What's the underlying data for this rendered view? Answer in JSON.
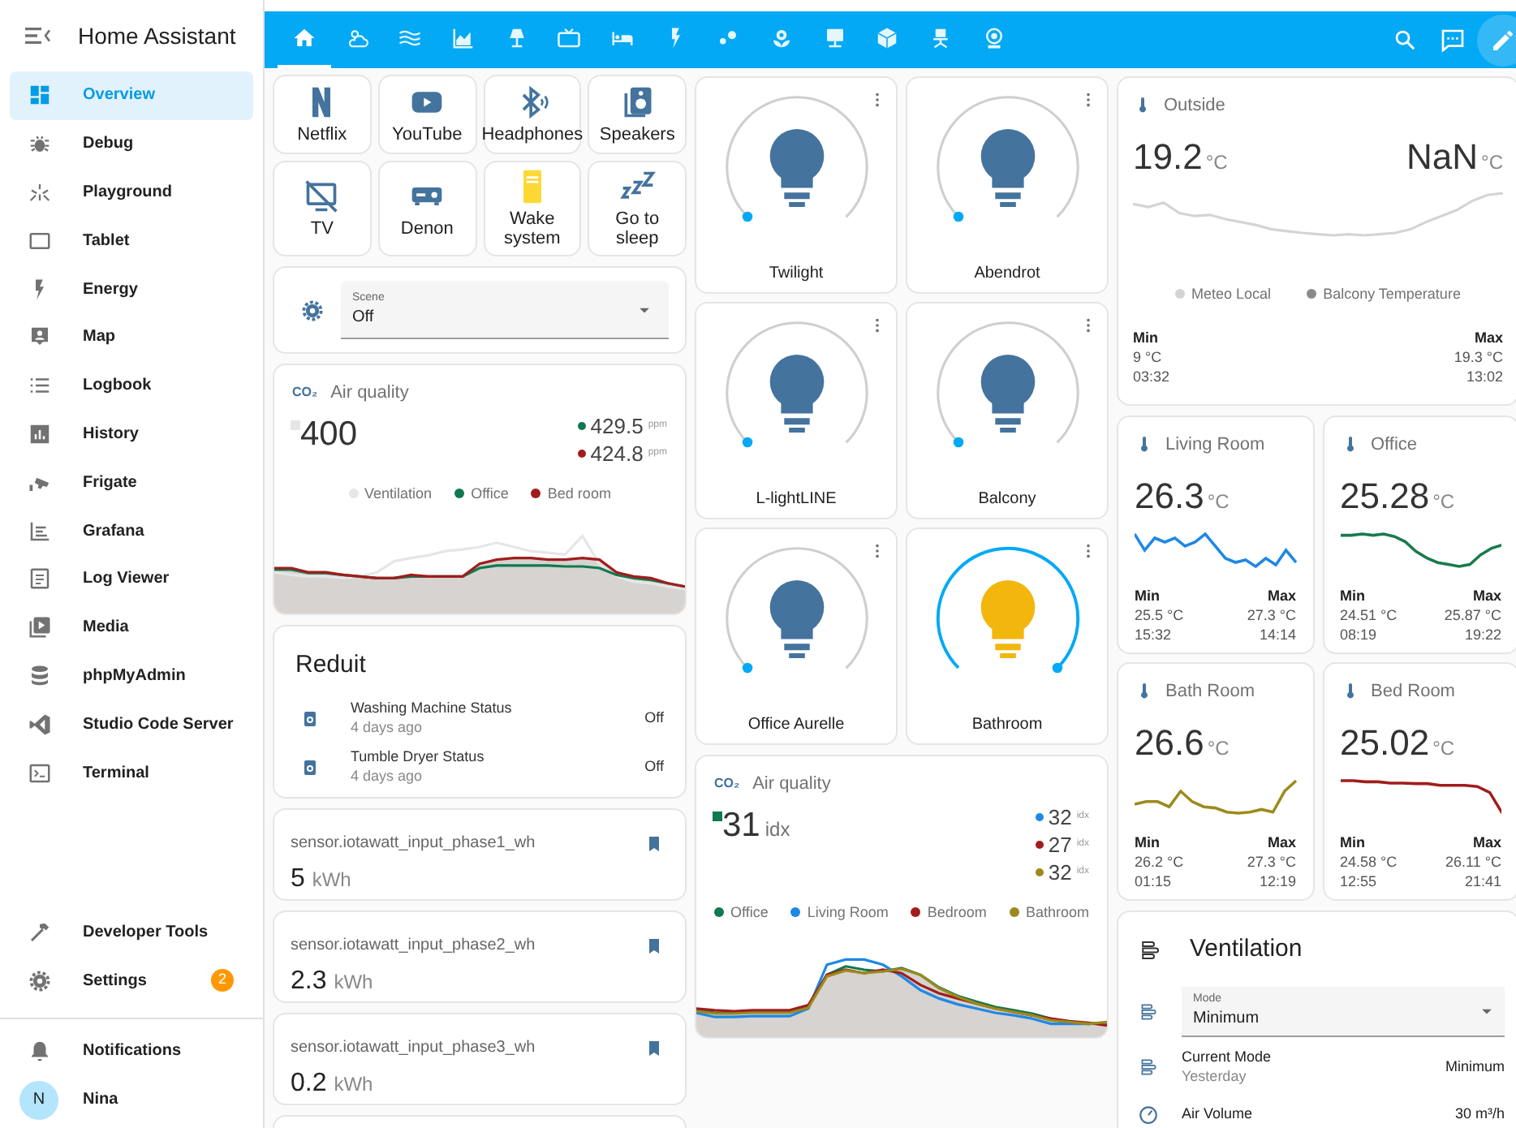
{
  "sidebar": {
    "title": "Home Assistant",
    "items": [
      {
        "label": "Overview",
        "selected": true
      },
      {
        "label": "Debug",
        "selected": false
      },
      {
        "label": "Playground",
        "selected": false
      },
      {
        "label": "Tablet",
        "selected": false
      },
      {
        "label": "Energy",
        "selected": false
      },
      {
        "label": "Map",
        "selected": false
      },
      {
        "label": "Logbook",
        "selected": false
      },
      {
        "label": "History",
        "selected": false
      },
      {
        "label": "Frigate",
        "selected": false
      },
      {
        "label": "Grafana",
        "selected": false
      },
      {
        "label": "Log Viewer",
        "selected": false
      },
      {
        "label": "Media",
        "selected": false
      },
      {
        "label": "phpMyAdmin",
        "selected": false
      },
      {
        "label": "Studio Code Server",
        "selected": false
      },
      {
        "label": "Terminal",
        "selected": false
      }
    ],
    "bottom_items": [
      {
        "label": "Developer Tools",
        "selected": false
      },
      {
        "label": "Settings",
        "selected": false,
        "badge": "2"
      }
    ],
    "notifications": {
      "label": "Notifications"
    },
    "user": {
      "initial": "N",
      "name": "Nina"
    }
  },
  "tabs": [
    {
      "selected": true
    },
    {
      "selected": false
    },
    {
      "selected": false
    },
    {
      "selected": false
    },
    {
      "selected": false
    },
    {
      "selected": false
    },
    {
      "selected": false
    },
    {
      "selected": false
    },
    {
      "selected": false
    },
    {
      "selected": false
    },
    {
      "selected": false
    },
    {
      "selected": false
    },
    {
      "selected": false
    },
    {
      "selected": false
    }
  ],
  "buttons": [
    {
      "label": "Netflix",
      "on": false
    },
    {
      "label": "YouTube",
      "on": false
    },
    {
      "label": "Headphones",
      "on": false
    },
    {
      "label": "Speakers",
      "on": false
    },
    {
      "label": "TV",
      "on": false
    },
    {
      "label": "Denon",
      "on": false
    },
    {
      "label": "Wake system",
      "on": true
    },
    {
      "label": "Go to sleep",
      "on": false
    }
  ],
  "scene": {
    "label": "Scene",
    "value": "Off"
  },
  "air_quality_1": {
    "icon_label": "CO₂",
    "title": "Air quality",
    "value": "400",
    "secondary": [
      {
        "value": "429.5",
        "unit": "ppm",
        "color": "#0f7a4f"
      },
      {
        "value": "424.8",
        "unit": "ppm",
        "color": "#a11d1d"
      }
    ],
    "legend": [
      {
        "label": "Ventilation",
        "color": "#e6e6e6"
      },
      {
        "label": "Office",
        "color": "#0f7a4f"
      },
      {
        "label": "Bed room",
        "color": "#a11d1d"
      }
    ]
  },
  "reduit": {
    "title": "Reduit",
    "rows": [
      {
        "name": "Washing Machine Status",
        "time": "4 days ago",
        "state": "Off"
      },
      {
        "name": "Tumble Dryer Status",
        "time": "4 days ago",
        "state": "Off"
      }
    ]
  },
  "sensors": [
    {
      "name": "sensor.iotawatt_input_phase1_wh",
      "value": "5",
      "unit": "kWh"
    },
    {
      "name": "sensor.iotawatt_input_phase2_wh",
      "value": "2.3",
      "unit": "kWh"
    },
    {
      "name": "sensor.iotawatt_input_phase3_wh",
      "value": "0.2",
      "unit": "kWh"
    }
  ],
  "lights": [
    {
      "name": "Twilight",
      "on": false
    },
    {
      "name": "Abendrot",
      "on": false
    },
    {
      "name": "L-lightLINE",
      "on": false
    },
    {
      "name": "Balcony",
      "on": false
    },
    {
      "name": "Office Aurelle",
      "on": false
    },
    {
      "name": "Bathroom",
      "on": true
    }
  ],
  "air_quality_2": {
    "icon_label": "CO₂",
    "title": "Air quality",
    "value": "31",
    "unit": "idx",
    "secondary": [
      {
        "value": "32",
        "unit": "idx",
        "color": "#1e88e5"
      },
      {
        "value": "27",
        "unit": "idx",
        "color": "#a11d1d"
      },
      {
        "value": "32",
        "unit": "idx",
        "color": "#9c8a1c"
      }
    ],
    "legend": [
      {
        "label": "Office",
        "color": "#0f7a4f"
      },
      {
        "label": "Living Room",
        "color": "#1e88e5"
      },
      {
        "label": "Bedroom",
        "color": "#a11d1d"
      },
      {
        "label": "Bathroom",
        "color": "#9c8a1c"
      }
    ]
  },
  "outside": {
    "title": "Outside",
    "value": "19.2",
    "unit": "°C",
    "value_2": "NaN",
    "unit_2": "°C",
    "legend": [
      {
        "label": "Meteo Local",
        "color": "#d4d4d4"
      },
      {
        "label": "Balcony Temperature",
        "color": "#8a8a8a"
      }
    ],
    "min_label": "Min",
    "min_value": "9 °C",
    "min_time": "03:32",
    "max_label": "Max",
    "max_value": "19.3 °C",
    "max_time": "13:02"
  },
  "rooms": [
    {
      "title": "Living Room",
      "value": "26.3",
      "unit": "°C",
      "color": "#1e88e5",
      "min_label": "Min",
      "min_value": "25.5 °C",
      "min_time": "15:32",
      "max_label": "Max",
      "max_value": "27.3 °C",
      "max_time": "14:14"
    },
    {
      "title": "Office",
      "value": "25.28",
      "unit": "°C",
      "color": "#1a7a4c",
      "min_label": "Min",
      "min_value": "24.51 °C",
      "min_time": "08:19",
      "max_label": "Max",
      "max_value": "25.87 °C",
      "max_time": "19:22"
    },
    {
      "title": "Bath Room",
      "value": "26.6",
      "unit": "°C",
      "color": "#9c8a1c",
      "min_label": "Min",
      "min_value": "26.2 °C",
      "min_time": "01:15",
      "max_label": "Max",
      "max_value": "27.3 °C",
      "max_time": "12:19"
    },
    {
      "title": "Bed Room",
      "value": "25.02",
      "unit": "°C",
      "color": "#a11d1d",
      "min_label": "Min",
      "min_value": "24.58 °C",
      "min_time": "12:55",
      "max_label": "Max",
      "max_value": "26.11 °C",
      "max_time": "21:41"
    }
  ],
  "ventilation": {
    "title": "Ventilation",
    "mode": {
      "label": "Mode",
      "value": "Minimum"
    },
    "rows": [
      {
        "name": "Current Mode",
        "secondary": "Yesterday",
        "state": "Minimum"
      },
      {
        "name": "Air Volume",
        "state": "30 m³/h"
      }
    ]
  }
}
